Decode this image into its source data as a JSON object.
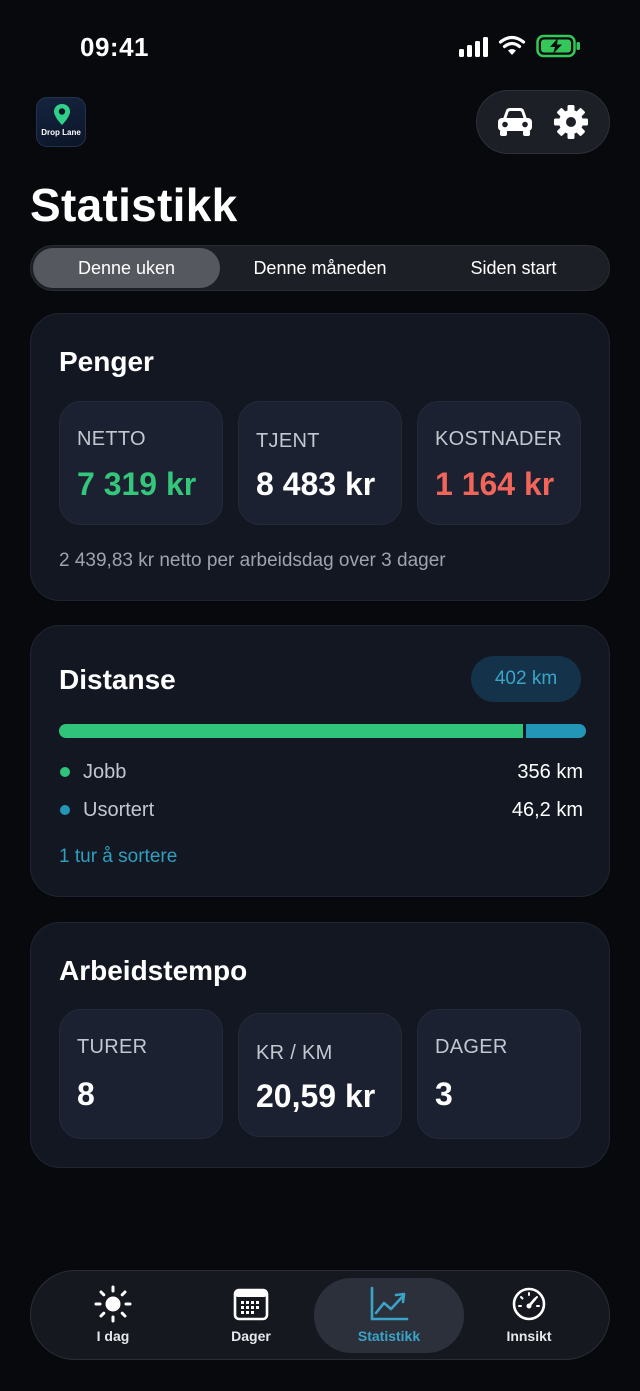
{
  "status_bar": {
    "time": "09:41"
  },
  "app": {
    "logo_text": "Drop Lane"
  },
  "page": {
    "title": "Statistikk"
  },
  "segments": [
    {
      "label": "Denne uken",
      "active": true
    },
    {
      "label": "Denne måneden",
      "active": false
    },
    {
      "label": "Siden start",
      "active": false
    }
  ],
  "money": {
    "title": "Penger",
    "tiles": [
      {
        "label": "NETTO",
        "value": "7 319 kr",
        "color": "#34c77b"
      },
      {
        "label": "TJENT",
        "value": "8 483 kr",
        "color": "#ffffff"
      },
      {
        "label": "KOSTNADER",
        "value": "1 164 kr",
        "color": "#f2655a"
      }
    ],
    "note": "2 439,83 kr netto per arbeidsdag over 3 dager"
  },
  "distance": {
    "title": "Distanse",
    "total": "402 km",
    "bar": {
      "work_km": 356,
      "unsorted_km": 46.2,
      "work_color": "#2fc479",
      "unsorted_color": "#2396b7"
    },
    "legend": [
      {
        "label": "Jobb",
        "value": "356 km",
        "color": "#2fc479"
      },
      {
        "label": "Usortert",
        "value": "46,2 km",
        "color": "#2396b7"
      }
    ],
    "link": "1 tur å sortere"
  },
  "pace": {
    "title": "Arbeidstempo",
    "tiles": [
      {
        "label": "TURER",
        "value": "8"
      },
      {
        "label": "KR / KM",
        "value": "20,59 kr"
      },
      {
        "label": "DAGER",
        "value": "3"
      }
    ]
  },
  "tabbar": [
    {
      "label": "I dag",
      "icon": "sun-icon",
      "active": false
    },
    {
      "label": "Dager",
      "icon": "calendar-icon",
      "active": false
    },
    {
      "label": "Statistikk",
      "icon": "chart-icon",
      "active": true
    },
    {
      "label": "Innsikt",
      "icon": "gauge-icon",
      "active": false
    }
  ],
  "colors": {
    "accent": "#3aa4c8",
    "positive": "#34c77b",
    "negative": "#f2655a",
    "background": "#07090d",
    "card": "#121722"
  }
}
